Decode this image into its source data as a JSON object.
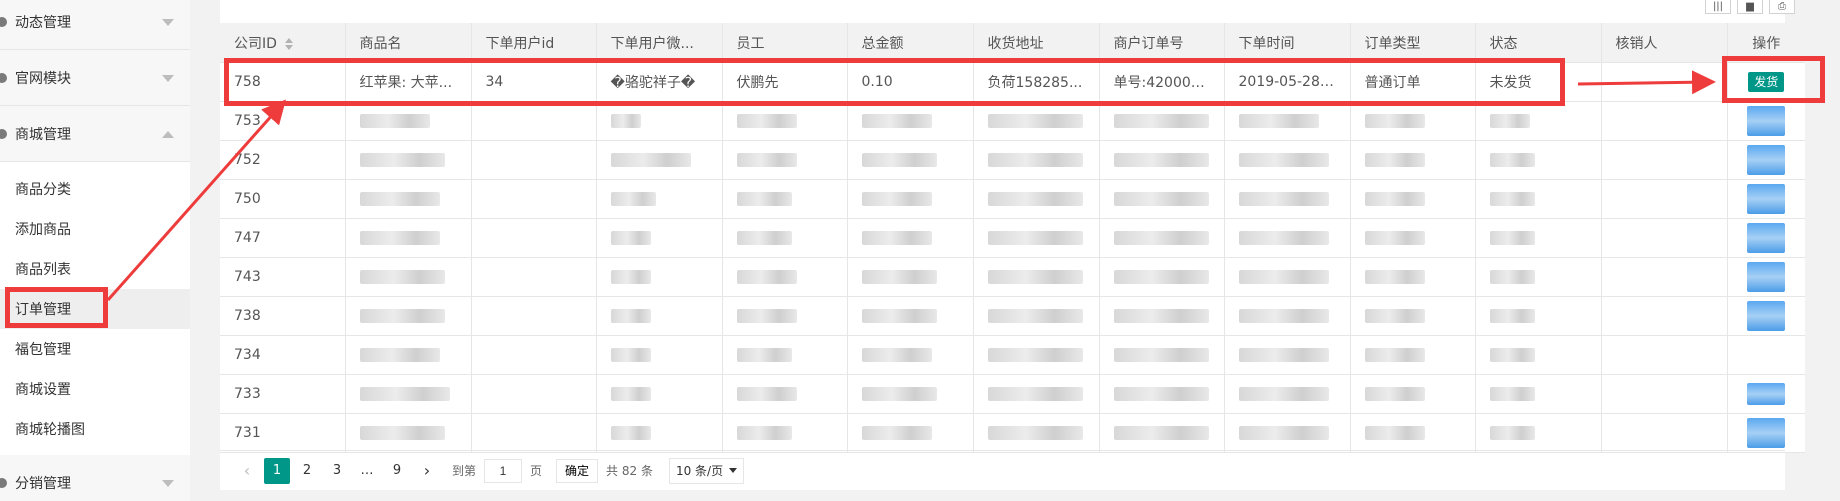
{
  "sidebar": {
    "sections": [
      {
        "label": "动态管理",
        "expanded": false
      },
      {
        "label": "官网模块",
        "expanded": false
      },
      {
        "label": "商城管理",
        "expanded": true
      },
      {
        "label": "分销管理",
        "expanded": false
      }
    ],
    "items": [
      {
        "label": "商品分类"
      },
      {
        "label": "添加商品"
      },
      {
        "label": "商品列表"
      },
      {
        "label": "订单管理",
        "active": true
      },
      {
        "label": "福包管理"
      },
      {
        "label": "商城设置"
      },
      {
        "label": "商城轮播图"
      }
    ]
  },
  "toolbar": {
    "icons": [
      "columns-icon",
      "export-icon",
      "print-icon"
    ]
  },
  "table": {
    "headers": [
      "公司ID",
      "商品名",
      "下单用户id",
      "下单用户微...",
      "员工",
      "总金额",
      "收货地址",
      "商户订单号",
      "下单时间",
      "订单类型",
      "状态",
      "核销人",
      "操作"
    ],
    "first_row": {
      "id": "758",
      "product": "红苹果: 大苹...",
      "user_id": "34",
      "user_wechat": "�骆驼祥子�",
      "staff": "伏鹏先",
      "amount": "0.10",
      "address": "负荷158285...",
      "merchant_order": "单号:420000...",
      "order_time": "2019-05-28 ...",
      "order_type": "普通订单",
      "status": "未发货",
      "verifier": "",
      "action": "发货"
    },
    "other_ids": [
      "753",
      "752",
      "750",
      "747",
      "743",
      "738",
      "734",
      "733",
      "731"
    ]
  },
  "pagination": {
    "prev": "‹",
    "pages": [
      "1",
      "2",
      "3",
      "…",
      "9"
    ],
    "current": "1",
    "next": "›",
    "goto_label": "到第",
    "goto_value": "1",
    "page_unit": "页",
    "confirm": "确定",
    "total": "共 82 条",
    "page_size": "10 条/页"
  },
  "colors": {
    "accent": "#009688",
    "annotation": "#ee3b3b"
  }
}
